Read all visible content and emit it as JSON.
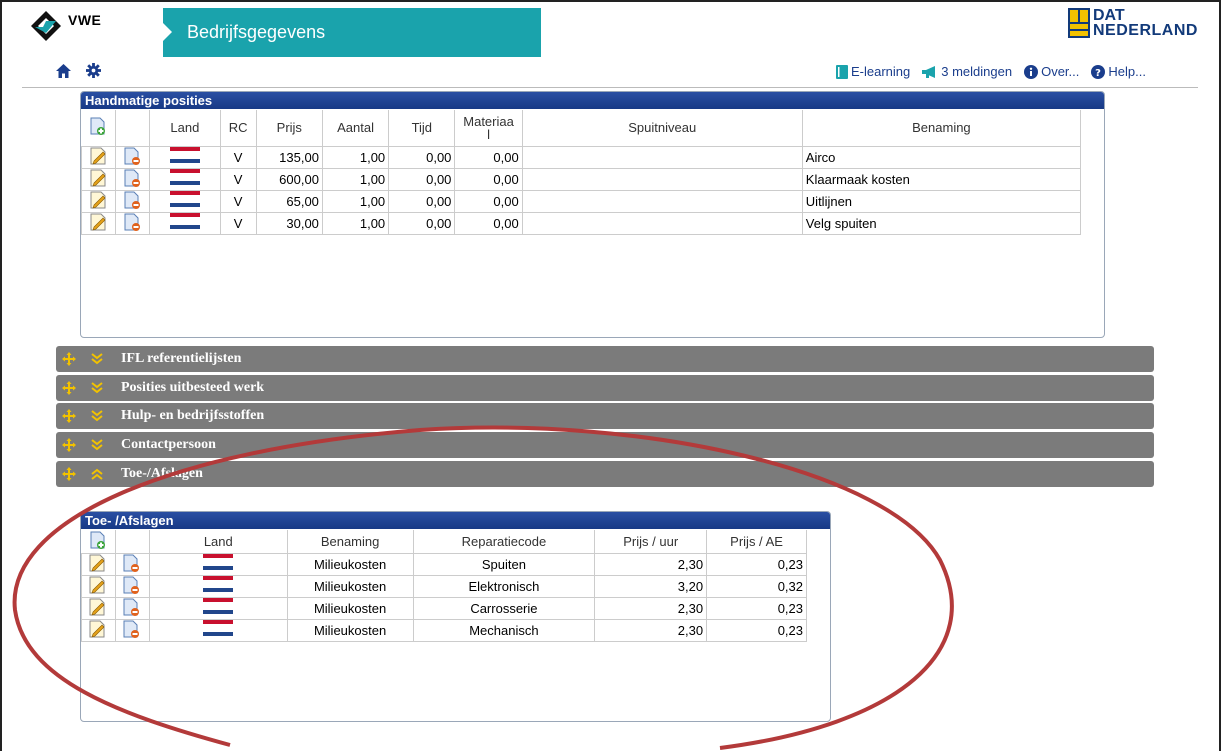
{
  "header": {
    "logo_text": "VWE",
    "title": "Bedrijfsgegevens",
    "dat_line1": "DAT",
    "dat_line2": "NEDERLAND"
  },
  "toplinks": [
    {
      "label": "E-learning",
      "icon": "book-icon"
    },
    {
      "label": "3 meldingen",
      "icon": "megaphone-icon"
    },
    {
      "label": "Over...",
      "icon": "info-icon"
    },
    {
      "label": "Help...",
      "icon": "help-icon"
    }
  ],
  "handmatige": {
    "title": "Handmatige posities",
    "columns": [
      "Land",
      "RC",
      "Prijs",
      "Aantal",
      "Tijd",
      "Materiaa\nl",
      "Spuitniveau",
      "Benaming"
    ],
    "rows": [
      {
        "rc": "V",
        "prijs": "135,00",
        "aantal": "1,00",
        "tijd": "0,00",
        "materiaal": "0,00",
        "spuitniveau": "",
        "benaming": "Airco"
      },
      {
        "rc": "V",
        "prijs": "600,00",
        "aantal": "1,00",
        "tijd": "0,00",
        "materiaal": "0,00",
        "spuitniveau": "",
        "benaming": "Klaarmaak kosten"
      },
      {
        "rc": "V",
        "prijs": "65,00",
        "aantal": "1,00",
        "tijd": "0,00",
        "materiaal": "0,00",
        "spuitniveau": "",
        "benaming": "Uitlijnen"
      },
      {
        "rc": "V",
        "prijs": "30,00",
        "aantal": "1,00",
        "tijd": "0,00",
        "materiaal": "0,00",
        "spuitniveau": "",
        "benaming": "Velg spuiten"
      }
    ]
  },
  "sections": [
    {
      "label": "IFL referentielijsten",
      "expanded": false
    },
    {
      "label": "Posities uitbesteed werk",
      "expanded": false
    },
    {
      "label": "Hulp- en bedrijfsstoffen",
      "expanded": false
    },
    {
      "label": "Contactpersoon",
      "expanded": false
    },
    {
      "label": "Toe-/Afslagen",
      "expanded": true
    }
  ],
  "afslagen": {
    "title": "Toe- /Afslagen",
    "columns": [
      "Land",
      "Benaming",
      "Reparatiecode",
      "Prijs / uur",
      "Prijs / AE"
    ],
    "rows": [
      {
        "benaming": "Milieukosten",
        "code": "Spuiten",
        "uur": "2,30",
        "ae": "0,23"
      },
      {
        "benaming": "Milieukosten",
        "code": "Elektronisch",
        "uur": "3,20",
        "ae": "0,32"
      },
      {
        "benaming": "Milieukosten",
        "code": "Carrosserie",
        "uur": "2,30",
        "ae": "0,23"
      },
      {
        "benaming": "Milieukosten",
        "code": "Mechanisch",
        "uur": "2,30",
        "ae": "0,23"
      }
    ]
  },
  "colors": {
    "teal": "#1aa3ac",
    "panel_header": "#1f4496",
    "bar": "#7b7b7b",
    "accent_yellow": "#f2c200",
    "annotation": "#b33a3a",
    "flag_red": "#c8102e",
    "flag_blue": "#21468b"
  }
}
